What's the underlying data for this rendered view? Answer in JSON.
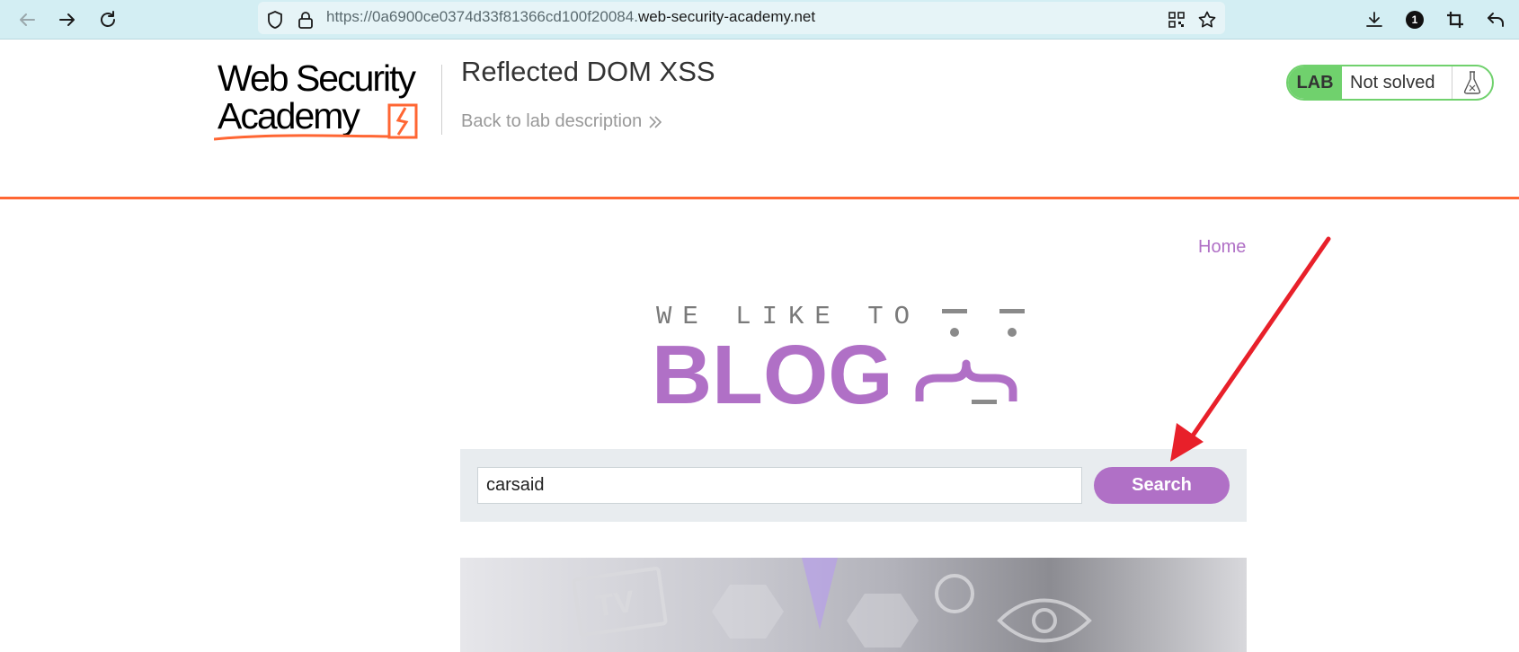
{
  "browser": {
    "url_prefix": "https://0a6900ce0374d33f81366cd100f20084.",
    "url_domain": "web-security-academy.net",
    "extensions_badge": "1"
  },
  "lab_header": {
    "logo_line1": "Web Security",
    "logo_line2": "Academy",
    "title": "Reflected DOM XSS",
    "back_link": "Back to lab description",
    "lab_badge": "LAB",
    "status": "Not solved"
  },
  "blog": {
    "home_link": "Home",
    "banner_top": "WE LIKE TO",
    "banner_bottom": "BLOG",
    "search_value": "carsaid",
    "search_button": "Search"
  },
  "colors": {
    "accent_orange": "#ff6633",
    "blog_purple": "#b070c6",
    "lab_green": "#70d16d",
    "annotation_red": "#e8202a"
  }
}
